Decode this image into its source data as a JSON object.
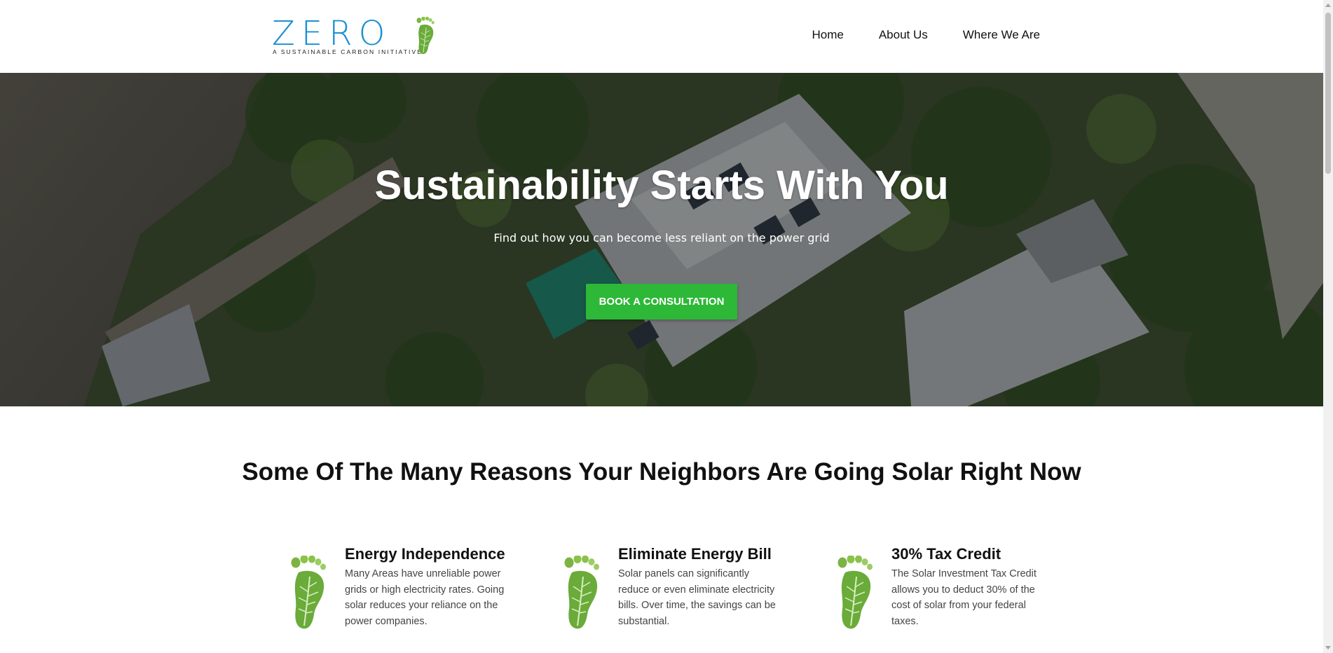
{
  "logo": {
    "word": "ZERO",
    "tagline": "A SUSTAINABLE CARBON INITIATIVE",
    "icon": "footprint-leaf-icon",
    "word_color": "#1b8fd3"
  },
  "nav": {
    "items": [
      {
        "label": "Home"
      },
      {
        "label": "About Us"
      },
      {
        "label": "Where We Are"
      }
    ]
  },
  "hero": {
    "title": "Sustainability Starts With You",
    "subtitle": "Find out how you can become less reliant on the power grid",
    "cta_label": "BOOK A CONSULTATION",
    "cta_color": "#2db838",
    "background": "aerial-photo-solar-houses-waterfront"
  },
  "reasons": {
    "title": "Some Of The Many Reasons Your Neighbors Are Going Solar Right Now",
    "items": [
      {
        "icon": "footprint-leaf-icon",
        "title": "Energy Independence",
        "text": "Many Areas have unreliable power grids or high electricity rates. Going solar reduces your reliance on the power companies."
      },
      {
        "icon": "footprint-leaf-icon",
        "title": "Eliminate Energy Bill",
        "text": "Solar panels can significantly reduce or even eliminate electricity bills. Over time, the savings can be substantial."
      },
      {
        "icon": "footprint-leaf-icon",
        "title": "30% Tax Credit",
        "text": "The Solar Investment Tax Credit allows you to deduct 30% of the cost of solar from your federal taxes."
      }
    ]
  }
}
